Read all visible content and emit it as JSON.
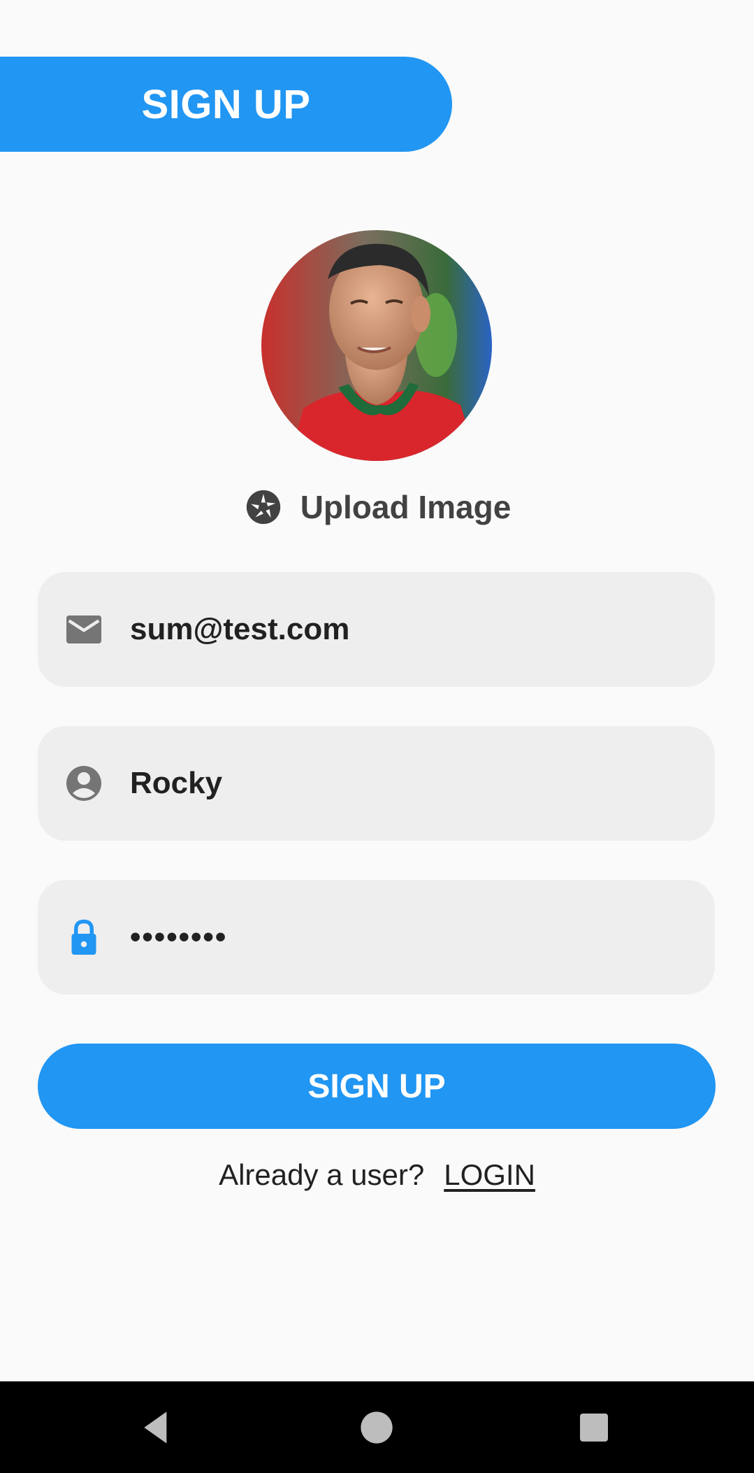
{
  "header": {
    "title": "SIGN UP"
  },
  "profile": {
    "avatar_icon": "profile-photo",
    "upload_label": "Upload Image",
    "upload_icon": "camera-aperture-icon"
  },
  "form": {
    "email": {
      "value": "sum@test.com",
      "icon": "mail-icon"
    },
    "name": {
      "value": "Rocky",
      "icon": "account-circle-icon"
    },
    "password": {
      "value": "••••••••",
      "icon": "lock-icon"
    },
    "submit_label": "SIGN UP"
  },
  "footer": {
    "prompt": "Already a user?",
    "login_label": "LOGIN"
  },
  "navbar": {
    "back_icon": "back-triangle-icon",
    "home_icon": "home-circle-icon",
    "recents_icon": "recents-square-icon"
  },
  "colors": {
    "accent": "#2196f3",
    "field_background": "#eeeeee",
    "page_background": "#fafafa",
    "navbar_background": "#000000"
  }
}
